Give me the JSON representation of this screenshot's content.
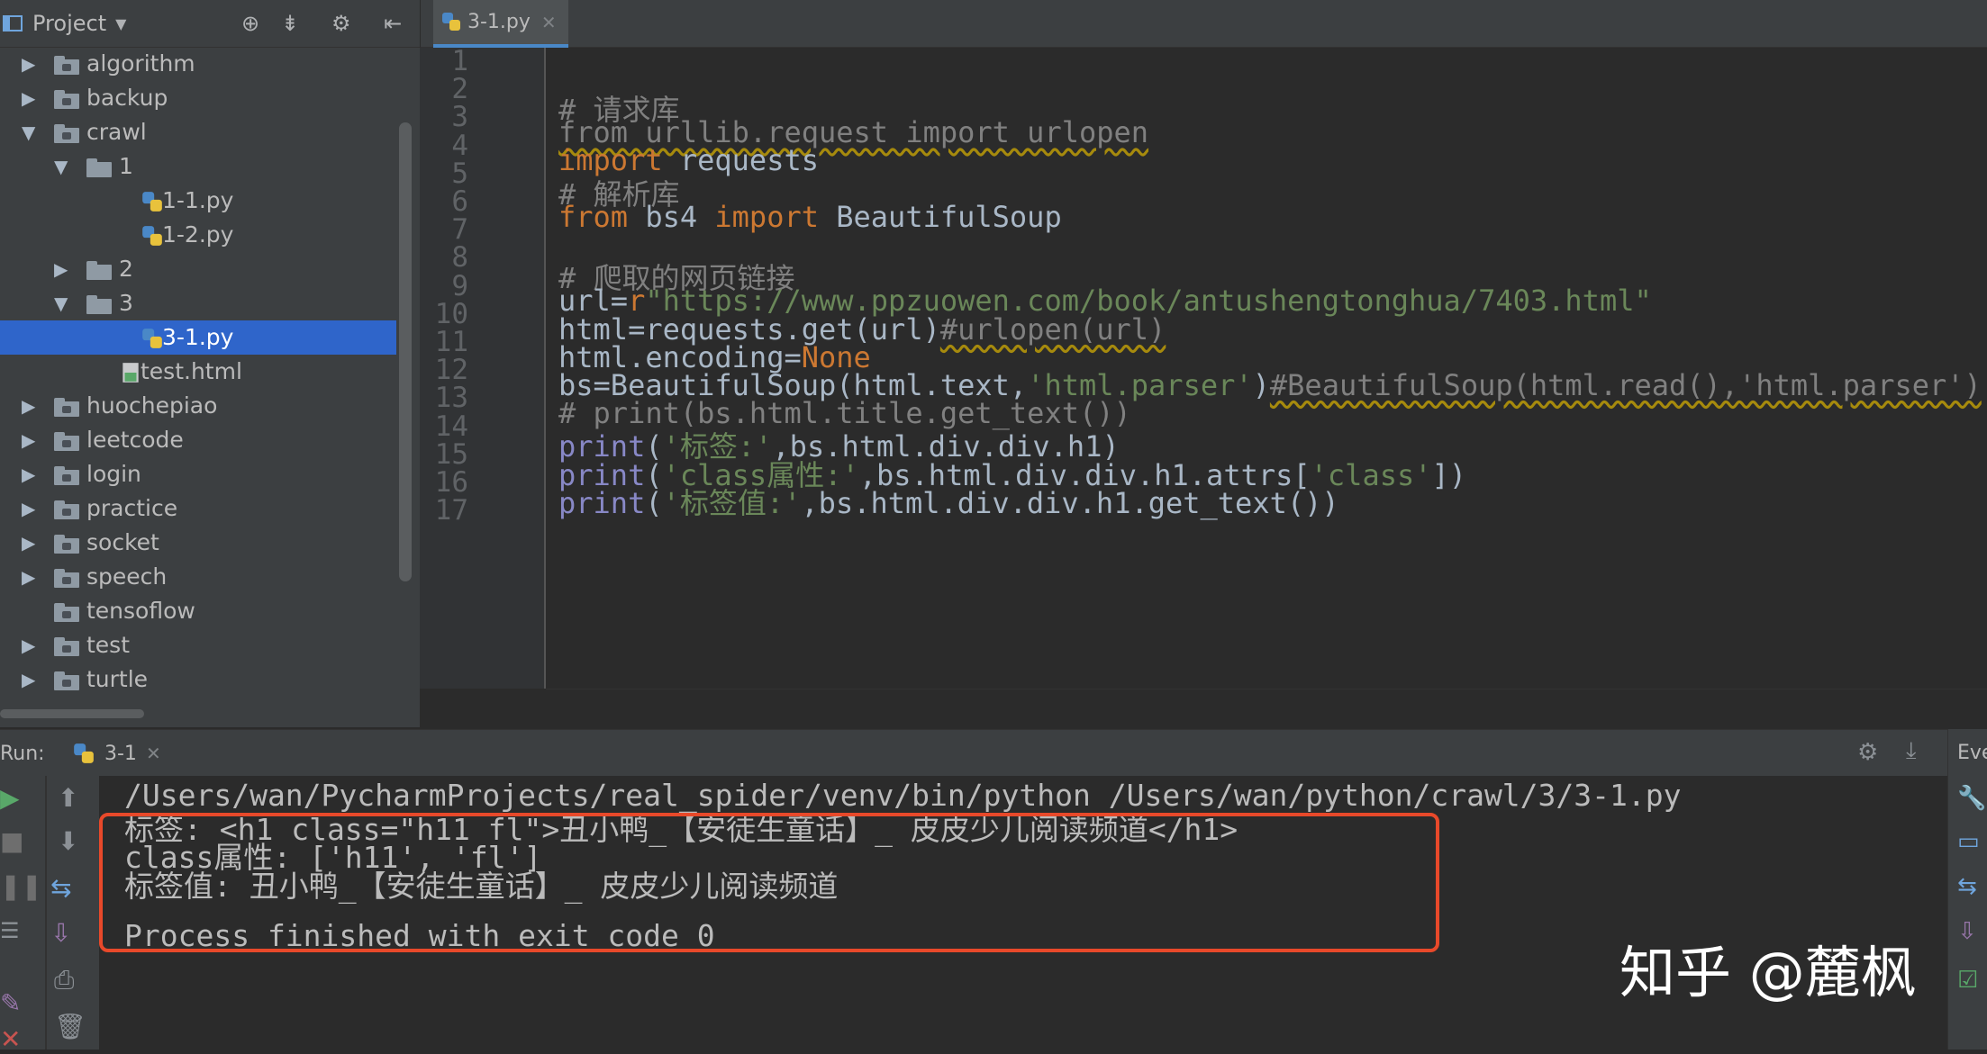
{
  "project_panel": {
    "title": "Project",
    "tree": [
      {
        "label": "algorithm",
        "type": "folder",
        "depth": 0,
        "expanded": false
      },
      {
        "label": "backup",
        "type": "folder",
        "depth": 0,
        "expanded": false
      },
      {
        "label": "crawl",
        "type": "folder",
        "depth": 0,
        "expanded": true
      },
      {
        "label": "1",
        "type": "folder",
        "depth": 1,
        "expanded": true
      },
      {
        "label": "1-1.py",
        "type": "py",
        "depth": 2
      },
      {
        "label": "1-2.py",
        "type": "py",
        "depth": 2
      },
      {
        "label": "2",
        "type": "folder",
        "depth": 1,
        "expanded": false
      },
      {
        "label": "3",
        "type": "folder",
        "depth": 1,
        "expanded": true
      },
      {
        "label": "3-1.py",
        "type": "py",
        "depth": 2,
        "selected": true
      },
      {
        "label": "test.html",
        "type": "html",
        "depth": 1
      },
      {
        "label": "huochepiao",
        "type": "folder",
        "depth": 0,
        "expanded": false
      },
      {
        "label": "leetcode",
        "type": "folder",
        "depth": 0,
        "expanded": false
      },
      {
        "label": "login",
        "type": "folder",
        "depth": 0,
        "expanded": false
      },
      {
        "label": "practice",
        "type": "folder",
        "depth": 0,
        "expanded": false
      },
      {
        "label": "socket",
        "type": "folder",
        "depth": 0,
        "expanded": false
      },
      {
        "label": "speech",
        "type": "folder",
        "depth": 0,
        "expanded": false
      },
      {
        "label": "tensoflow",
        "type": "folder",
        "depth": 0,
        "noarrow": true
      },
      {
        "label": "test",
        "type": "folder",
        "depth": 0,
        "expanded": false
      },
      {
        "label": "turtle",
        "type": "folder",
        "depth": 0,
        "expanded": false
      }
    ]
  },
  "editor": {
    "tab_label": "3-1.py",
    "line_numbers": [
      "1",
      "2",
      "3",
      "4",
      "5",
      "6",
      "7",
      "8",
      "9",
      "10",
      "11",
      "12",
      "13",
      "14",
      "15",
      "16",
      "17"
    ],
    "lines": [
      {
        "text": "# 请求库",
        "class": "cm"
      },
      {
        "text": "from urllib.request import urlopen",
        "class": "ulc"
      },
      {
        "text": "import requests"
      },
      {
        "text": "# 解析库",
        "class": "cm"
      },
      {
        "text": "from bs4 import BeautifulSoup"
      },
      {
        "text": ""
      },
      {
        "text": "# 爬取的网页链接",
        "class": "cm"
      },
      {
        "text": "url=r\"https://www.ppzuowen.com/book/antushengtonghua/7403.html\""
      },
      {
        "text": "html=requests.get(url)#urlopen(url)"
      },
      {
        "text": "html.encoding=None"
      },
      {
        "text": "bs=BeautifulSoup(html.text,'html.parser')#BeautifulSoup(html.read(),'html.parser')"
      },
      {
        "text": "# print(bs.html.title.get_text())",
        "class": "cm"
      },
      {
        "text": "print('标签:',bs.html.div.div.h1)"
      },
      {
        "text": "print('class属性:',bs.html.div.div.h1.attrs['class'])"
      },
      {
        "text": "print('标签值:',bs.html.div.div.h1.get_text())"
      },
      {
        "text": ""
      }
    ]
  },
  "run_panel": {
    "label": "Run:",
    "tab_label": "3-1",
    "right_label": "Eve",
    "console_lines": [
      "/Users/wan/PycharmProjects/real_spider/venv/bin/python /Users/wan/python/crawl/3/3-1.py",
      "标签: <h1 class=\"h11 fl\">丑小鸭_【安徒生童话】_ 皮皮少儿阅读频道</h1>",
      "class属性: ['h11', 'fl']",
      "标签值: 丑小鸭_【安徒生童话】_ 皮皮少儿阅读频道",
      "",
      "Process finished with exit code 0"
    ]
  },
  "watermark": "知乎 @麓枫",
  "colors": {
    "selection": "#2f65ca",
    "highlight_box": "#e8492a",
    "keyword": "#cc7832",
    "string": "#6a8759",
    "comment": "#808080",
    "builtin": "#8888c6"
  }
}
